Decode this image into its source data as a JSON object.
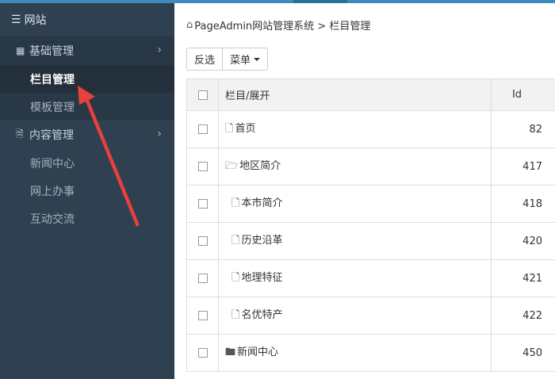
{
  "sidebar": {
    "header": {
      "icon": "menu-icon",
      "label": "网站"
    },
    "groups": [
      {
        "icon": "grid-icon",
        "label": "基础管理",
        "items": [
          {
            "label": "栏目管理",
            "active": true
          },
          {
            "label": "模板管理",
            "active": false
          }
        ]
      },
      {
        "icon": "document-icon",
        "label": "内容管理",
        "items": [
          {
            "label": "新闻中心"
          },
          {
            "label": "网上办事"
          },
          {
            "label": "互动交流"
          }
        ]
      }
    ]
  },
  "breadcrumb": {
    "icon": "home-icon",
    "text": "PageAdmin网站管理系统 > 栏目管理"
  },
  "toolbar": {
    "invert_label": "反选",
    "menu_label": "菜单"
  },
  "table": {
    "headers": {
      "name": "栏目/展开",
      "id": "Id"
    },
    "rows": [
      {
        "icon": "file-icon",
        "name": "首页",
        "id": "82",
        "level": 0
      },
      {
        "icon": "folder-open-icon",
        "name": "地区简介",
        "id": "417",
        "level": 0
      },
      {
        "icon": "file-icon",
        "name": "本市简介",
        "id": "418",
        "level": 1
      },
      {
        "icon": "file-icon",
        "name": "历史沿革",
        "id": "420",
        "level": 1
      },
      {
        "icon": "file-icon",
        "name": "地理特征",
        "id": "421",
        "level": 1
      },
      {
        "icon": "file-icon",
        "name": "名优特产",
        "id": "422",
        "level": 1
      },
      {
        "icon": "folder-icon",
        "name": "新闻中心",
        "id": "450",
        "level": 0
      }
    ]
  },
  "colors": {
    "sidebar_bg": "#2f4050",
    "top_accent": "#3c8dbc",
    "annotation_arrow": "#e8403c"
  }
}
